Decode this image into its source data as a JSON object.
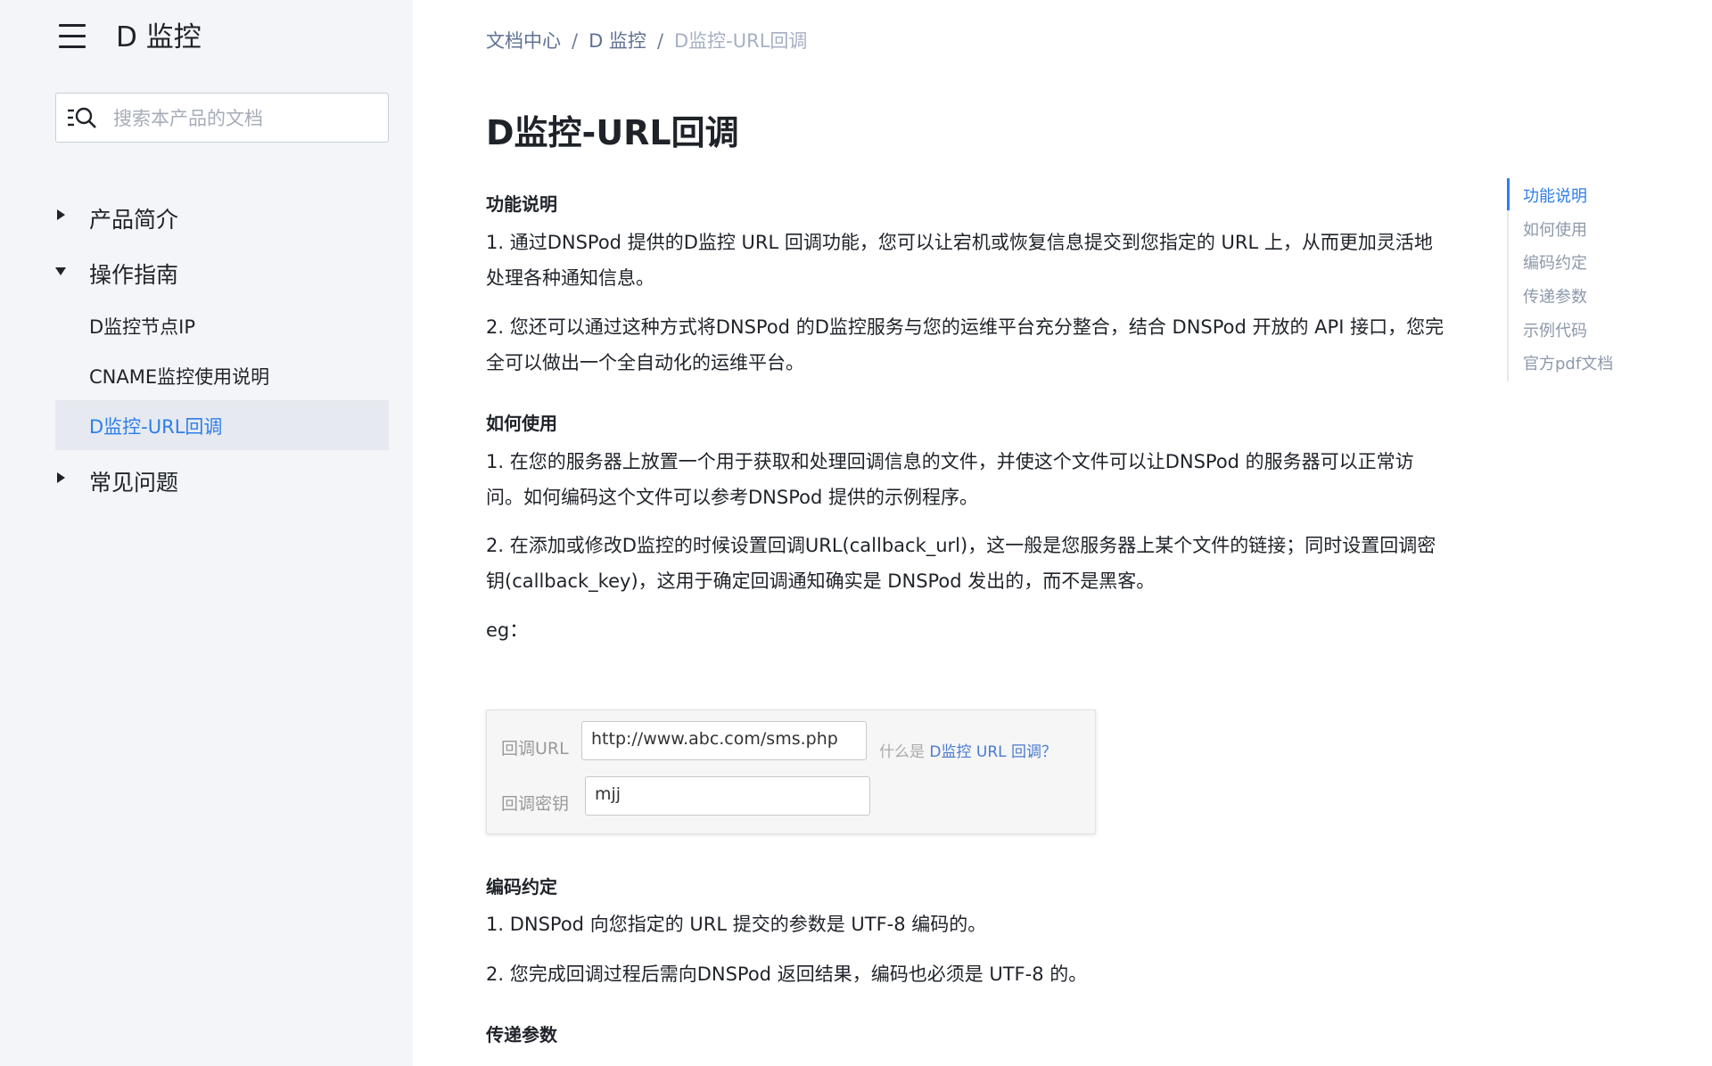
{
  "sidebar": {
    "product_title": "D 监控",
    "search_placeholder": "搜索本产品的文档",
    "items": [
      {
        "label": "产品简介"
      },
      {
        "label": "操作指南"
      },
      {
        "label": "常见问题"
      }
    ],
    "sub_items": [
      {
        "label": "D监控节点IP"
      },
      {
        "label": "CNAME监控使用说明"
      },
      {
        "label": "D监控-URL回调",
        "active": true
      }
    ]
  },
  "breadcrumb": {
    "items": [
      "文档中心",
      "D 监控"
    ],
    "separator": "/",
    "current": "D监控-URL回调"
  },
  "page": {
    "title": "D监控-URL回调"
  },
  "sections": {
    "s1_heading": "功能说明",
    "s1_p1_l1": "1. 通过DNSPod 提供的D监控 URL 回调功能，您可以让宕机或恢复信息提交到您指定的 URL 上，从而更加灵活地",
    "s1_p1_l2": "处理各种通知信息。",
    "s1_p2_l1": "2. 您还可以通过这种方式将DNSPod 的D监控服务与您的运维平台充分整合，结合 DNSPod 开放的 API 接口，您完",
    "s1_p2_l2": "全可以做出一个全自动化的运维平台。",
    "s2_heading": "如何使用",
    "s2_p1_l1": "1. 在您的服务器上放置一个用于获取和处理回调信息的文件，并使这个文件可以让DNSPod 的服务器可以正常访",
    "s2_p1_l2": "问。如何编码这个文件可以参考DNSPod 提供的示例程序。",
    "s2_p2_l1": "2. 在添加或修改D监控的时候设置回调URL(callback_url)，这一般是您服务器上某个文件的链接；同时设置回调密",
    "s2_p2_l2": "钥(callback_key)，这用于确定回调通知确实是 DNSPod 发出的，而不是黑客。",
    "s2_eg": "eg：",
    "s3_heading": "编码约定",
    "s3_p1": "1. DNSPod 向您指定的 URL 提交的参数是 UTF-8 编码的。",
    "s3_p2": "2. 您完成回调过程后需向DNSPod 返回结果，编码也必须是 UTF-8 的。",
    "s4_heading": "传递参数"
  },
  "example": {
    "url_label": "回调URL",
    "url_value": "http://www.abc.com/sms.php",
    "help_prefix": "什么是",
    "help_link": "D监控 URL 回调？",
    "key_label": "回调密钥",
    "key_value": "mjj"
  },
  "toc": {
    "items": [
      "功能说明",
      "如何使用",
      "编码约定",
      "传递参数",
      "示例代码",
      "官方pdf文档"
    ],
    "active_index": 0
  },
  "colors": {
    "accent": "#2d7eea",
    "sidebar_bg": "#f3f5f8",
    "active_item_bg": "#e6eaf0"
  },
  "icons": {
    "menu": "hamburger-menu-icon",
    "search": "search-list-icon"
  }
}
